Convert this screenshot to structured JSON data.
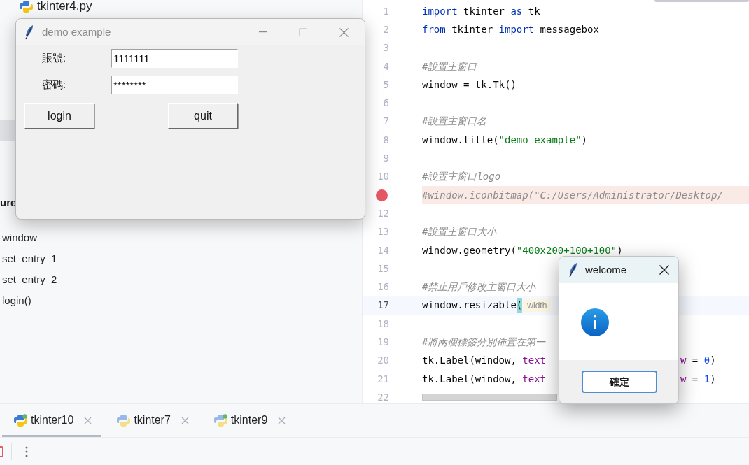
{
  "project_tree": {
    "file": "tkinter4.py"
  },
  "structure": {
    "header": "ure",
    "items": [
      "window",
      "set_entry_1",
      "set_entry_2",
      "login()"
    ]
  },
  "editor": {
    "lines": [
      {
        "number": "1",
        "breakpoint": false,
        "current": false,
        "tokens": [
          {
            "kind": "keyword",
            "text": "import"
          },
          {
            "kind": "plain",
            "text": " tkinter "
          },
          {
            "kind": "keyword",
            "text": "as"
          },
          {
            "kind": "plain",
            "text": " tk"
          }
        ]
      },
      {
        "number": "2",
        "breakpoint": false,
        "current": false,
        "tokens": [
          {
            "kind": "keyword",
            "text": "from"
          },
          {
            "kind": "plain",
            "text": " tkinter "
          },
          {
            "kind": "keyword",
            "text": "import"
          },
          {
            "kind": "plain",
            "text": " messagebox"
          }
        ]
      },
      {
        "number": "3",
        "breakpoint": false,
        "current": false
      },
      {
        "number": "4",
        "breakpoint": false,
        "current": false,
        "tokens": [
          {
            "kind": "comment",
            "text": "#設置主窗口"
          }
        ]
      },
      {
        "number": "5",
        "breakpoint": false,
        "current": false,
        "tokens": [
          {
            "kind": "plain",
            "text": "window = tk.Tk()"
          }
        ]
      },
      {
        "number": "6",
        "breakpoint": false,
        "current": false
      },
      {
        "number": "7",
        "breakpoint": false,
        "current": false,
        "tokens": [
          {
            "kind": "comment",
            "text": "#設置主窗口名"
          }
        ]
      },
      {
        "number": "8",
        "breakpoint": false,
        "current": false,
        "tokens": [
          {
            "kind": "plain",
            "text": "window.title("
          },
          {
            "kind": "string",
            "text": "\"demo example\""
          },
          {
            "kind": "plain",
            "text": ")"
          }
        ]
      },
      {
        "number": "9",
        "breakpoint": false,
        "current": false
      },
      {
        "number": "10",
        "breakpoint": false,
        "current": false,
        "tokens": [
          {
            "kind": "comment",
            "text": "#設置主窗口logo"
          }
        ]
      },
      {
        "breakpoint": true,
        "current": false,
        "tokens": [
          {
            "kind": "comment",
            "text": "#window.iconbitmap(\"C:/Users/Administrator/Desktop/"
          }
        ]
      },
      {
        "number": "12",
        "breakpoint": false,
        "current": false
      },
      {
        "number": "13",
        "breakpoint": false,
        "current": false,
        "tokens": [
          {
            "kind": "comment",
            "text": "#設置主窗口大小"
          }
        ]
      },
      {
        "number": "14",
        "breakpoint": false,
        "current": false,
        "tokens": [
          {
            "kind": "plain",
            "text": "window.geometry("
          },
          {
            "kind": "string",
            "text": "\"400x200+100+100\""
          },
          {
            "kind": "plain",
            "text": ")"
          }
        ]
      },
      {
        "number": "15",
        "breakpoint": false,
        "current": false
      },
      {
        "number": "16",
        "breakpoint": false,
        "current": false,
        "tokens": [
          {
            "kind": "comment",
            "text": "#禁止用戶修改主窗口大小"
          }
        ]
      },
      {
        "number": "17",
        "breakpoint": false,
        "current": true,
        "tokens": [
          {
            "kind": "plain",
            "text": "window.resizable"
          },
          {
            "kind": "brace",
            "text": "("
          },
          {
            "kind": "hint",
            "text": "width"
          }
        ]
      },
      {
        "number": "18",
        "breakpoint": false,
        "current": false
      },
      {
        "number": "19",
        "breakpoint": false,
        "current": false,
        "tokens": [
          {
            "kind": "comment",
            "text": "#將兩個標簽分別佈置在第一"
          }
        ]
      },
      {
        "number": "20",
        "breakpoint": false,
        "current": false,
        "tokens": [
          {
            "kind": "plain",
            "text": "tk.Label(window, "
          },
          {
            "kind": "param",
            "text": "text"
          }
        ],
        "tail": [
          {
            "kind": "param",
            "text": "w"
          },
          {
            "kind": "plain",
            "text": " = "
          },
          {
            "kind": "number",
            "text": "0"
          },
          {
            "kind": "plain",
            "text": ")"
          }
        ]
      },
      {
        "number": "21",
        "breakpoint": false,
        "current": false,
        "tokens": [
          {
            "kind": "plain",
            "text": "tk.Label(window, "
          },
          {
            "kind": "param",
            "text": "text"
          }
        ],
        "tail": [
          {
            "kind": "param",
            "text": "w"
          },
          {
            "kind": "plain",
            "text": " = "
          },
          {
            "kind": "number",
            "text": "1"
          },
          {
            "kind": "plain",
            "text": ")"
          }
        ]
      },
      {
        "number": "22",
        "breakpoint": false,
        "current": false
      }
    ]
  },
  "bottom_tabs": [
    {
      "label": "tkinter10",
      "selected": true,
      "dot": true
    },
    {
      "label": "tkinter7",
      "selected": false,
      "dot": false
    },
    {
      "label": "tkinter9",
      "selected": false,
      "dot": true
    }
  ],
  "demo_window": {
    "title": "demo example",
    "fields": [
      {
        "label": "賬號:",
        "value": "1111111"
      },
      {
        "label": "密碼:",
        "value": "********"
      }
    ],
    "buttons": [
      "login",
      "quit"
    ]
  },
  "message_box": {
    "title": "welcome",
    "button": "確定"
  }
}
